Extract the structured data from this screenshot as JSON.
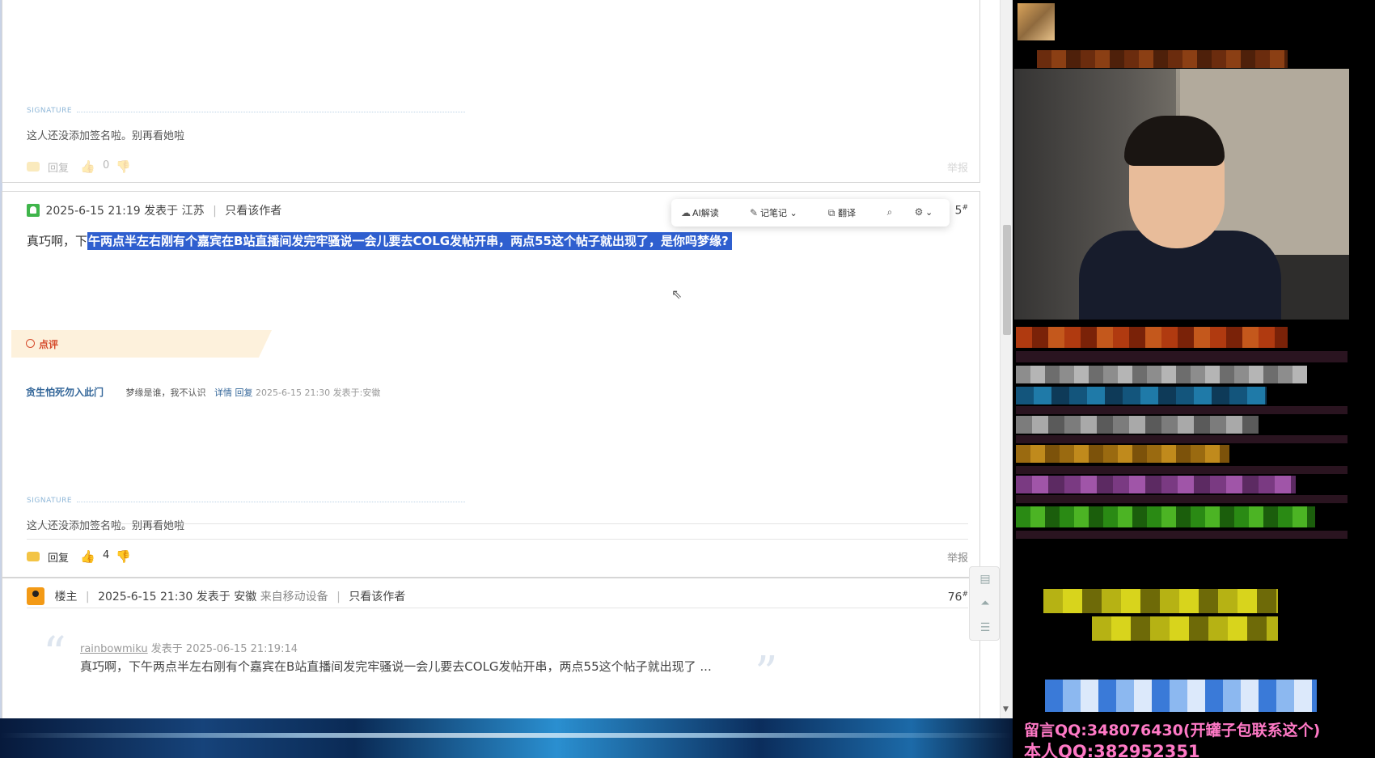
{
  "top_post": {
    "signature_header": "SIGNATURE",
    "signature_text": "这人还没添加签名啦。别再看她啦",
    "reply_label": "回复",
    "like_count": "0",
    "report_label": "举报"
  },
  "post_75": {
    "timestamp": "2025-6-15 21:19 发表于 江苏",
    "only_author": "只看该作者",
    "floor": "5",
    "floor_suffix": "#",
    "body_plain": "真巧啊，下",
    "body_selected": "午两点半左右刚有个嘉宾在B站直播间发完牢骚说一会儿要去COLG发帖开串，两点55这个帖子就出现了，是你吗梦缘?",
    "review_label": "点评",
    "review_user": "贪生怕死勿入此门",
    "review_text": "梦缘是谁，我不认识",
    "review_detail": "详情",
    "review_reply": "回复",
    "review_time": "2025-6-15 21:30 发表于:安徽",
    "signature_header": "SIGNATURE",
    "signature_text": "这人还没添加签名啦。别再看她啦",
    "reply_label": "回复",
    "like_count": "4",
    "report_label": "举报"
  },
  "selection_toolbar": {
    "ai_read": "AI解读",
    "notes": "记笔记",
    "translate": "翻译"
  },
  "post_76": {
    "op_label": "楼主",
    "timestamp": "2025-6-15 21:30 发表于 安徽",
    "device": "来自移动设备",
    "only_author": "只看该作者",
    "floor": "76",
    "floor_suffix": "#",
    "quote_author": "rainbowmiku",
    "quote_posted": "发表于 2025-06-15 21:19:14",
    "quote_text": "真巧啊，下午两点半左右刚有个嘉宾在B站直播间发完牢骚说一会儿要去COLG发帖开串，两点55这个帖子就出现了 ..."
  },
  "stream_overlay": {
    "line1": "留言QQ:348076430(开罐子包联系这个)",
    "line2": "本人QQ:382952351"
  },
  "colors": {
    "highlight": "#2f5fcf",
    "link": "#336699",
    "review_accent": "#d54a2b",
    "overlay_text": "#ff79c6"
  }
}
